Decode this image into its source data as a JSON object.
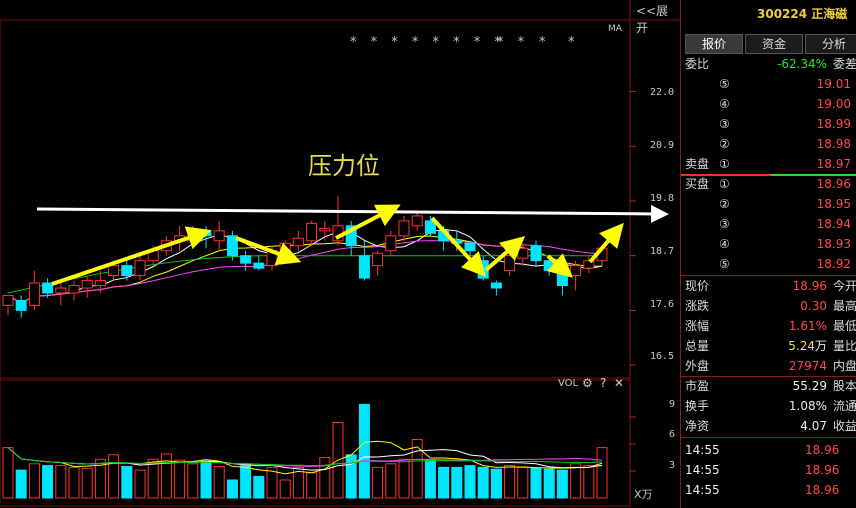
{
  "toolbar": {
    "expand_label": "<<展开",
    "ma_label": "MA"
  },
  "stars": {
    "left": "* * * * * * * *",
    "mid": "* *",
    "r1": "*",
    "r2": "*"
  },
  "annotation": {
    "text": "压力位"
  },
  "price_axis": {
    "ticks": [
      "22.0",
      "20.9",
      "19.8",
      "18.7",
      "17.6",
      "16.5"
    ]
  },
  "volume_panel": {
    "label": "VOL",
    "ticks": [
      "9",
      "6",
      "3"
    ],
    "unit": "X万",
    "gear_icon": "⚙",
    "help_icon": "?",
    "close_icon": "✕"
  },
  "colors": {
    "up": "#ff3030",
    "down": "#00e5ff",
    "arrow": "#ffff00",
    "ma5": "#ffffff",
    "ma10": "#ffff00",
    "ma20": "#ff40ff",
    "ma60": "#00d000"
  },
  "chart_data": {
    "type": "candlestick",
    "ylim": [
      16.2,
      23.4
    ],
    "candles": [
      {
        "o": 17.7,
        "h": 17.9,
        "l": 17.5,
        "c": 17.9
      },
      {
        "o": 17.8,
        "h": 17.9,
        "l": 17.45,
        "c": 17.6
      },
      {
        "o": 17.7,
        "h": 18.4,
        "l": 17.6,
        "c": 18.15
      },
      {
        "o": 18.15,
        "h": 18.25,
        "l": 17.85,
        "c": 17.95
      },
      {
        "o": 17.95,
        "h": 18.15,
        "l": 17.7,
        "c": 18.05
      },
      {
        "o": 17.95,
        "h": 18.2,
        "l": 17.8,
        "c": 18.1
      },
      {
        "o": 18.05,
        "h": 18.3,
        "l": 17.85,
        "c": 18.2
      },
      {
        "o": 18.1,
        "h": 18.4,
        "l": 17.95,
        "c": 18.2
      },
      {
        "o": 18.3,
        "h": 18.6,
        "l": 18.2,
        "c": 18.5
      },
      {
        "o": 18.5,
        "h": 18.6,
        "l": 18.2,
        "c": 18.3
      },
      {
        "o": 18.3,
        "h": 18.7,
        "l": 18.2,
        "c": 18.6
      },
      {
        "o": 18.6,
        "h": 18.9,
        "l": 18.5,
        "c": 18.8
      },
      {
        "o": 18.8,
        "h": 19.1,
        "l": 18.7,
        "c": 19.0
      },
      {
        "o": 19.0,
        "h": 19.3,
        "l": 18.8,
        "c": 19.1
      },
      {
        "o": 19.0,
        "h": 19.3,
        "l": 18.9,
        "c": 19.2
      },
      {
        "o": 19.2,
        "h": 19.3,
        "l": 18.85,
        "c": 19.1
      },
      {
        "o": 19.0,
        "h": 19.4,
        "l": 18.8,
        "c": 19.2
      },
      {
        "o": 19.1,
        "h": 19.2,
        "l": 18.6,
        "c": 18.7
      },
      {
        "o": 18.7,
        "h": 18.8,
        "l": 18.4,
        "c": 18.55
      },
      {
        "o": 18.55,
        "h": 18.7,
        "l": 18.4,
        "c": 18.45
      },
      {
        "o": 18.5,
        "h": 18.9,
        "l": 18.4,
        "c": 18.8
      },
      {
        "o": 18.8,
        "h": 19.0,
        "l": 18.7,
        "c": 18.95
      },
      {
        "o": 18.9,
        "h": 19.2,
        "l": 18.8,
        "c": 19.05
      },
      {
        "o": 19.0,
        "h": 19.4,
        "l": 18.9,
        "c": 19.35
      },
      {
        "o": 19.2,
        "h": 19.4,
        "l": 19.0,
        "c": 19.25
      },
      {
        "o": 19.0,
        "h": 19.9,
        "l": 18.9,
        "c": 19.3
      },
      {
        "o": 19.3,
        "h": 19.4,
        "l": 18.7,
        "c": 18.9
      },
      {
        "o": 18.7,
        "h": 19.0,
        "l": 18.2,
        "c": 18.25
      },
      {
        "o": 18.5,
        "h": 18.8,
        "l": 18.3,
        "c": 18.75
      },
      {
        "o": 18.8,
        "h": 19.2,
        "l": 18.7,
        "c": 19.1
      },
      {
        "o": 19.1,
        "h": 19.5,
        "l": 19.0,
        "c": 19.4
      },
      {
        "o": 19.3,
        "h": 19.6,
        "l": 19.2,
        "c": 19.5
      },
      {
        "o": 19.4,
        "h": 19.5,
        "l": 19.1,
        "c": 19.15
      },
      {
        "o": 19.2,
        "h": 19.3,
        "l": 18.8,
        "c": 19.0
      },
      {
        "o": 19.0,
        "h": 19.2,
        "l": 18.8,
        "c": 18.95
      },
      {
        "o": 18.95,
        "h": 19.0,
        "l": 18.7,
        "c": 18.8
      },
      {
        "o": 18.6,
        "h": 18.7,
        "l": 18.2,
        "c": 18.25
      },
      {
        "o": 18.15,
        "h": 18.2,
        "l": 17.9,
        "c": 18.05
      },
      {
        "o": 18.4,
        "h": 18.8,
        "l": 18.3,
        "c": 18.7
      },
      {
        "o": 18.65,
        "h": 18.95,
        "l": 18.5,
        "c": 18.85
      },
      {
        "o": 18.9,
        "h": 19.0,
        "l": 18.5,
        "c": 18.6
      },
      {
        "o": 18.6,
        "h": 18.7,
        "l": 18.3,
        "c": 18.4
      },
      {
        "o": 18.4,
        "h": 18.5,
        "l": 17.9,
        "c": 18.1
      },
      {
        "o": 18.3,
        "h": 18.6,
        "l": 18.0,
        "c": 18.5
      },
      {
        "o": 18.45,
        "h": 18.7,
        "l": 18.35,
        "c": 18.6
      },
      {
        "o": 18.6,
        "h": 18.9,
        "l": 18.5,
        "c": 18.85
      }
    ],
    "volume": [
      5.6,
      3.1,
      3.8,
      3.6,
      3.6,
      3.4,
      3.3,
      4.3,
      4.8,
      3.5,
      3.1,
      4.3,
      4.9,
      4.2,
      3.8,
      4.1,
      3.5,
      2.0,
      3.6,
      2.4,
      3.4,
      2.0,
      3.4,
      2.8,
      4.5,
      8.4,
      4.8,
      10.4,
      3.4,
      3.8,
      4.3,
      6.5,
      4.2,
      3.4,
      3.4,
      3.6,
      3.4,
      3.2,
      3.6,
      3.4,
      3.3,
      3.2,
      3.1,
      3.8,
      3.6,
      5.6
    ]
  },
  "stock": {
    "code": "300224",
    "name": "正海磁"
  },
  "tabs": [
    "报价",
    "资金",
    "分析"
  ],
  "weibi": {
    "label": "委比",
    "value": "-62.34%",
    "extra": "委差"
  },
  "sell": [
    {
      "label": "",
      "level": "⑤",
      "price": "19.01"
    },
    {
      "label": "",
      "level": "④",
      "price": "19.00"
    },
    {
      "label": "",
      "level": "③",
      "price": "18.99"
    },
    {
      "label": "",
      "level": "②",
      "price": "18.98"
    },
    {
      "label": "卖盘",
      "level": "①",
      "price": "18.97"
    }
  ],
  "buy": [
    {
      "label": "买盘",
      "level": "①",
      "price": "18.96"
    },
    {
      "label": "",
      "level": "②",
      "price": "18.95"
    },
    {
      "label": "",
      "level": "③",
      "price": "18.94"
    },
    {
      "label": "",
      "level": "④",
      "price": "18.93"
    },
    {
      "label": "",
      "level": "⑤",
      "price": "18.92"
    }
  ],
  "quote": [
    {
      "k": "现价",
      "v": "18.96",
      "vu": "",
      "x": "今开",
      "cls": "red"
    },
    {
      "k": "涨跌",
      "v": "0.30",
      "vu": "",
      "x": "最高",
      "cls": "red"
    },
    {
      "k": "涨幅",
      "v": "1.61%",
      "vu": "",
      "x": "最低",
      "cls": "red"
    },
    {
      "k": "总量",
      "v": "5.24",
      "vu": "万",
      "x": "量比",
      "cls": "yel"
    },
    {
      "k": "外盘",
      "v": "27974",
      "vu": "",
      "x": "内盘",
      "cls": "red"
    }
  ],
  "fund": [
    {
      "k": "市盈",
      "v": "55.29",
      "x": "股本"
    },
    {
      "k": "换手",
      "v": "1.08%",
      "x": "流通"
    },
    {
      "k": "净资",
      "v": "4.07",
      "x": "收益"
    }
  ],
  "trades": [
    {
      "time": "14:55",
      "price": "18.96"
    },
    {
      "time": "14:55",
      "price": "18.96"
    },
    {
      "time": "14:55",
      "price": "18.96"
    }
  ]
}
